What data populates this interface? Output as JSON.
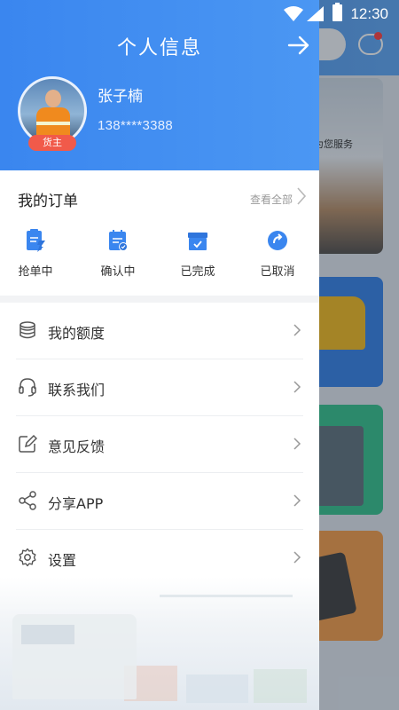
{
  "status_bar": {
    "time": "12:30"
  },
  "drawer": {
    "title": "个人信息",
    "user": {
      "name": "张子楠",
      "phone": "138****3388",
      "role_badge": "货主"
    },
    "orders": {
      "title": "我的订单",
      "view_all": "查看全部",
      "statuses": [
        {
          "label": "抢单中",
          "icon": "grab-order-icon"
        },
        {
          "label": "确认中",
          "icon": "confirming-icon"
        },
        {
          "label": "已完成",
          "icon": "completed-icon"
        },
        {
          "label": "已取消",
          "icon": "cancelled-icon"
        }
      ]
    },
    "menu": [
      {
        "label": "我的额度",
        "icon": "quota-icon"
      },
      {
        "label": "联系我们",
        "icon": "headset-icon"
      },
      {
        "label": "意见反馈",
        "icon": "feedback-icon"
      },
      {
        "label": "分享APP",
        "icon": "share-icon"
      },
      {
        "label": "设置",
        "icon": "gear-icon"
      }
    ]
  },
  "background": {
    "banner_text": "为您服务"
  },
  "colors": {
    "primary": "#3a86ef",
    "badge": "#f15a4a",
    "text": "#333333"
  }
}
